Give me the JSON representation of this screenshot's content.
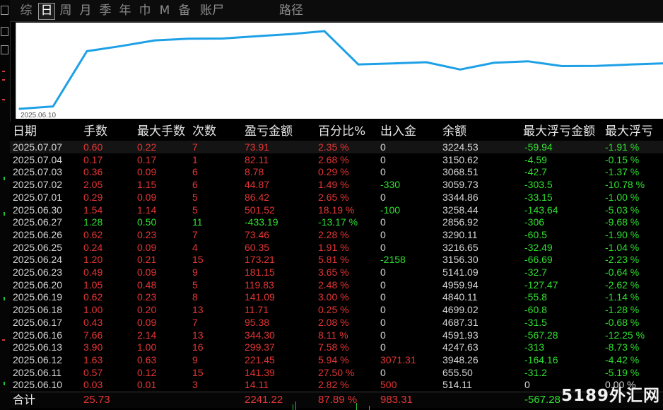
{
  "tabs": [
    {
      "label": "综",
      "active": false
    },
    {
      "label": "日",
      "active": true
    },
    {
      "label": "周",
      "active": false
    },
    {
      "label": "月",
      "active": false
    },
    {
      "label": "季",
      "active": false
    },
    {
      "label": "年",
      "active": false
    },
    {
      "label": "巾",
      "active": false
    },
    {
      "label": "M",
      "active": false
    },
    {
      "label": "备",
      "active": false
    },
    {
      "label": "账尸",
      "active": false
    },
    {
      "label": "路径",
      "active": false
    }
  ],
  "chart_data": {
    "type": "line",
    "start_label": "2025.06.10",
    "x": [
      "2025.06.10",
      "2025.06.11",
      "2025.06.12",
      "2025.06.13",
      "2025.06.16",
      "2025.06.17",
      "2025.06.18",
      "2025.06.19",
      "2025.06.20",
      "2025.06.23",
      "2025.06.24",
      "2025.06.25",
      "2025.06.26",
      "2025.06.27",
      "2025.06.30",
      "2025.07.01",
      "2025.07.02",
      "2025.07.03",
      "2025.07.04",
      "2025.07.07"
    ],
    "y": [
      514.11,
      655.5,
      3948.26,
      4247.63,
      4591.93,
      4687.31,
      4699.02,
      4840.11,
      4959.94,
      5141.09,
      3156.3,
      3216.65,
      3290.11,
      2856.92,
      3258.44,
      3344.86,
      3059.73,
      3068.51,
      3150.62,
      3224.53
    ],
    "color": "#1ea0e6"
  },
  "table": {
    "headers": [
      "日期",
      "手数",
      "最大手数",
      "次数",
      "盈亏金额",
      "百分比%",
      "出入金",
      "余额",
      "最大浮亏金额",
      "最大浮亏"
    ],
    "rows": [
      {
        "date": "2025.07.07",
        "lots": "0.60",
        "max_lots": "0.22",
        "count": "7",
        "pnl": "73.91",
        "pct": "2.35 %",
        "flow": "0",
        "balance": "3224.53",
        "max_float": "-59.94",
        "max_float_pct": "-1.91 %",
        "tone": "red"
      },
      {
        "date": "2025.07.04",
        "lots": "0.17",
        "max_lots": "0.17",
        "count": "1",
        "pnl": "82.11",
        "pct": "2.68 %",
        "flow": "0",
        "balance": "3150.62",
        "max_float": "-4.59",
        "max_float_pct": "-0.15 %",
        "tone": "red"
      },
      {
        "date": "2025.07.03",
        "lots": "0.36",
        "max_lots": "0.09",
        "count": "6",
        "pnl": "8.78",
        "pct": "0.29 %",
        "flow": "0",
        "balance": "3068.51",
        "max_float": "-42.7",
        "max_float_pct": "-1.37 %",
        "tone": "red"
      },
      {
        "date": "2025.07.02",
        "lots": "2.05",
        "max_lots": "1.15",
        "count": "6",
        "pnl": "44.87",
        "pct": "1.49 %",
        "flow": "-330",
        "balance": "3059.73",
        "max_float": "-303.5",
        "max_float_pct": "-10.78 %",
        "tone": "red",
        "flow_tone": "green"
      },
      {
        "date": "2025.07.01",
        "lots": "0.29",
        "max_lots": "0.09",
        "count": "5",
        "pnl": "86.42",
        "pct": "2.65 %",
        "flow": "0",
        "balance": "3344.86",
        "max_float": "-33.15",
        "max_float_pct": "-1.00 %",
        "tone": "red"
      },
      {
        "date": "2025.06.30",
        "lots": "1.54",
        "max_lots": "1.14",
        "count": "5",
        "pnl": "501.52",
        "pct": "18.19 %",
        "flow": "-100",
        "balance": "3258.44",
        "max_float": "-143.64",
        "max_float_pct": "-5.03 %",
        "tone": "red",
        "flow_tone": "green"
      },
      {
        "date": "2025.06.27",
        "lots": "1.28",
        "max_lots": "0.50",
        "count": "11",
        "pnl": "-433.19",
        "pct": "-13.17 %",
        "flow": "0",
        "balance": "2856.92",
        "max_float": "-306",
        "max_float_pct": "-9.68 %",
        "tone": "green"
      },
      {
        "date": "2025.06.26",
        "lots": "0.62",
        "max_lots": "0.23",
        "count": "7",
        "pnl": "73.46",
        "pct": "2.28 %",
        "flow": "0",
        "balance": "3290.11",
        "max_float": "-60.5",
        "max_float_pct": "-1.90 %",
        "tone": "red"
      },
      {
        "date": "2025.06.25",
        "lots": "0.24",
        "max_lots": "0.09",
        "count": "4",
        "pnl": "60.35",
        "pct": "1.91 %",
        "flow": "0",
        "balance": "3216.65",
        "max_float": "-32.49",
        "max_float_pct": "-1.04 %",
        "tone": "red"
      },
      {
        "date": "2025.06.24",
        "lots": "1.20",
        "max_lots": "0.21",
        "count": "15",
        "pnl": "173.21",
        "pct": "5.81 %",
        "flow": "-2158",
        "balance": "3156.30",
        "max_float": "-66.69",
        "max_float_pct": "-2.23 %",
        "tone": "red",
        "flow_tone": "green"
      },
      {
        "date": "2025.06.23",
        "lots": "0.49",
        "max_lots": "0.09",
        "count": "9",
        "pnl": "181.15",
        "pct": "3.65 %",
        "flow": "0",
        "balance": "5141.09",
        "max_float": "-32.7",
        "max_float_pct": "-0.64 %",
        "tone": "red"
      },
      {
        "date": "2025.06.20",
        "lots": "1.05",
        "max_lots": "0.48",
        "count": "5",
        "pnl": "119.83",
        "pct": "2.48 %",
        "flow": "0",
        "balance": "4959.94",
        "max_float": "-127.47",
        "max_float_pct": "-2.62 %",
        "tone": "red"
      },
      {
        "date": "2025.06.19",
        "lots": "0.62",
        "max_lots": "0.23",
        "count": "8",
        "pnl": "141.09",
        "pct": "3.00 %",
        "flow": "0",
        "balance": "4840.11",
        "max_float": "-55.8",
        "max_float_pct": "-1.14 %",
        "tone": "red"
      },
      {
        "date": "2025.06.18",
        "lots": "1.00",
        "max_lots": "0.20",
        "count": "13",
        "pnl": "11.71",
        "pct": "0.25 %",
        "flow": "0",
        "balance": "4699.02",
        "max_float": "-60.8",
        "max_float_pct": "-1.28 %",
        "tone": "red"
      },
      {
        "date": "2025.06.17",
        "lots": "0.43",
        "max_lots": "0.09",
        "count": "7",
        "pnl": "95.38",
        "pct": "2.08 %",
        "flow": "0",
        "balance": "4687.31",
        "max_float": "-31.5",
        "max_float_pct": "-0.68 %",
        "tone": "red"
      },
      {
        "date": "2025.06.16",
        "lots": "7.66",
        "max_lots": "2.14",
        "count": "13",
        "pnl": "344.30",
        "pct": "8.11 %",
        "flow": "0",
        "balance": "4591.93",
        "max_float": "-567.28",
        "max_float_pct": "-12.25 %",
        "tone": "red"
      },
      {
        "date": "2025.06.13",
        "lots": "3.90",
        "max_lots": "1.00",
        "count": "16",
        "pnl": "299.37",
        "pct": "7.58 %",
        "flow": "0",
        "balance": "4247.63",
        "max_float": "-313",
        "max_float_pct": "-8.73 %",
        "tone": "red"
      },
      {
        "date": "2025.06.12",
        "lots": "1.63",
        "max_lots": "0.63",
        "count": "9",
        "pnl": "221.45",
        "pct": "5.94 %",
        "flow": "3071.31",
        "balance": "3948.26",
        "max_float": "-164.16",
        "max_float_pct": "-4.42 %",
        "tone": "red",
        "flow_tone": "red"
      },
      {
        "date": "2025.06.11",
        "lots": "0.57",
        "max_lots": "0.12",
        "count": "15",
        "pnl": "141.39",
        "pct": "27.50 %",
        "flow": "0",
        "balance": "655.50",
        "max_float": "-31.2",
        "max_float_pct": "-5.19 %",
        "tone": "red"
      },
      {
        "date": "2025.06.10",
        "lots": "0.03",
        "max_lots": "0.01",
        "count": "3",
        "pnl": "14.11",
        "pct": "2.82 %",
        "flow": "500",
        "balance": "514.11",
        "max_float": "0",
        "max_float_pct": "0.00 %",
        "tone": "red",
        "flow_tone": "red",
        "float_tone": "white"
      }
    ],
    "total": {
      "label": "合计",
      "lots": "25.73",
      "pnl": "2241.22",
      "pct": "87.89 %",
      "flow": "983.31",
      "max_float": "-567.28"
    }
  },
  "watermark": "5189外汇网"
}
